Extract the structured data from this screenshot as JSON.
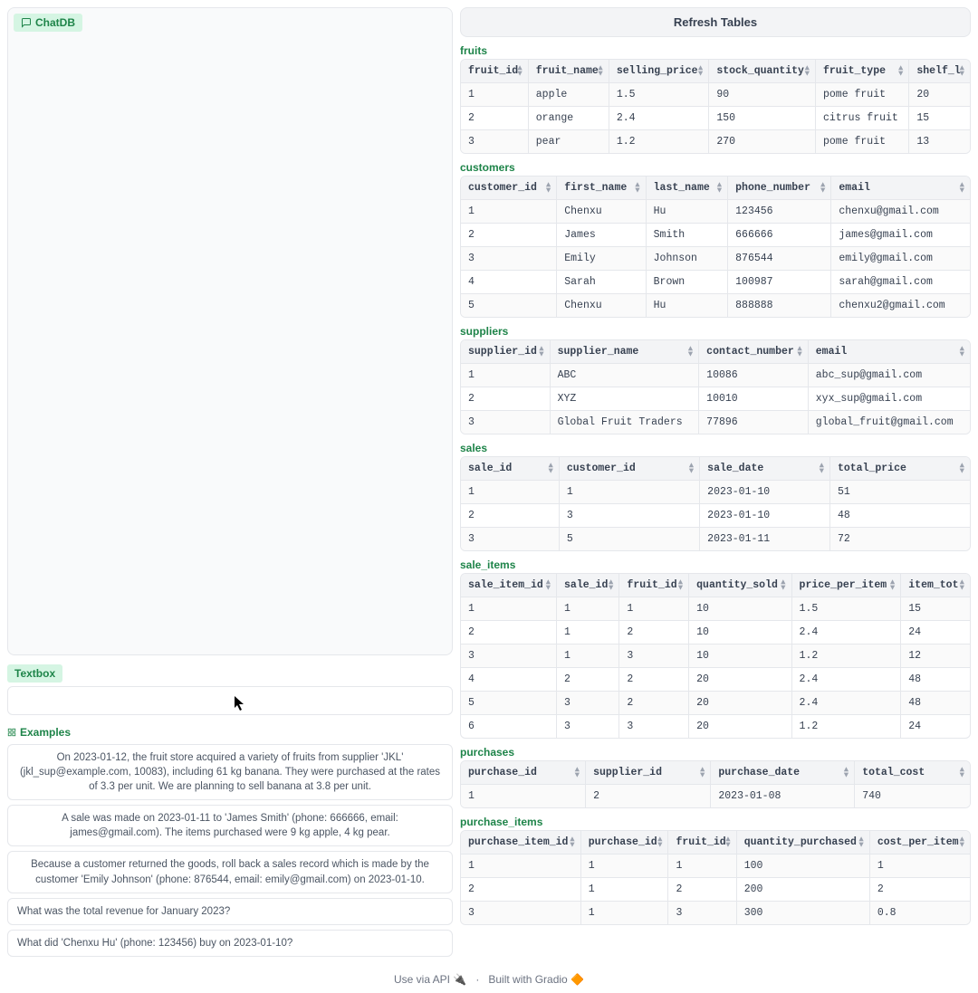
{
  "chat": {
    "label": "ChatDB"
  },
  "textbox": {
    "label": "Textbox",
    "placeholder": ""
  },
  "examples": {
    "label": "Examples",
    "items": [
      "On 2023-01-12, the fruit store acquired a variety of fruits from supplier 'JKL' (jkl_sup@example.com, 10083), including 61 kg banana. They were purchased at the rates of 3.3 per unit. We are planning to sell banana at 3.8 per unit.",
      "A sale was made on 2023-01-11 to 'James Smith' (phone: 666666, email: james@gmail.com). The items purchased were 9 kg apple, 4 kg pear.",
      "Because a customer returned the goods, roll back a sales record which is made by the customer 'Emily Johnson' (phone: 876544, email: emily@gmail.com) on 2023-01-10.",
      "What was the total revenue for January 2023?",
      "What did 'Chenxu Hu' (phone: 123456) buy on 2023-01-10?"
    ]
  },
  "refresh_label": "Refresh Tables",
  "tables": [
    {
      "name": "fruits",
      "columns": [
        "fruit_id",
        "fruit_name",
        "selling_price",
        "stock_quantity",
        "fruit_type",
        "shelf_l"
      ],
      "rows": [
        [
          "1",
          "apple",
          "1.5",
          "90",
          "pome fruit",
          "20"
        ],
        [
          "2",
          "orange",
          "2.4",
          "150",
          "citrus fruit",
          "15"
        ],
        [
          "3",
          "pear",
          "1.2",
          "270",
          "pome fruit",
          "13"
        ]
      ]
    },
    {
      "name": "customers",
      "columns": [
        "customer_id",
        "first_name",
        "last_name",
        "phone_number",
        "email"
      ],
      "rows": [
        [
          "1",
          "Chenxu",
          "Hu",
          "123456",
          "chenxu@gmail.com"
        ],
        [
          "2",
          "James",
          "Smith",
          "666666",
          "james@gmail.com"
        ],
        [
          "3",
          "Emily",
          "Johnson",
          "876544",
          "emily@gmail.com"
        ],
        [
          "4",
          "Sarah",
          "Brown",
          "100987",
          "sarah@gmail.com"
        ],
        [
          "5",
          "Chenxu",
          "Hu",
          "888888",
          "chenxu2@gmail.com"
        ]
      ]
    },
    {
      "name": "suppliers",
      "columns": [
        "supplier_id",
        "supplier_name",
        "contact_number",
        "email"
      ],
      "rows": [
        [
          "1",
          "ABC",
          "10086",
          "abc_sup@gmail.com"
        ],
        [
          "2",
          "XYZ",
          "10010",
          "xyx_sup@gmail.com"
        ],
        [
          "3",
          "Global Fruit Traders",
          "77896",
          "global_fruit@gmail.com"
        ]
      ]
    },
    {
      "name": "sales",
      "columns": [
        "sale_id",
        "customer_id",
        "sale_date",
        "total_price"
      ],
      "rows": [
        [
          "1",
          "1",
          "2023-01-10",
          "51"
        ],
        [
          "2",
          "3",
          "2023-01-10",
          "48"
        ],
        [
          "3",
          "5",
          "2023-01-11",
          "72"
        ]
      ]
    },
    {
      "name": "sale_items",
      "columns": [
        "sale_item_id",
        "sale_id",
        "fruit_id",
        "quantity_sold",
        "price_per_item",
        "item_tot"
      ],
      "rows": [
        [
          "1",
          "1",
          "1",
          "10",
          "1.5",
          "15"
        ],
        [
          "2",
          "1",
          "2",
          "10",
          "2.4",
          "24"
        ],
        [
          "3",
          "1",
          "3",
          "10",
          "1.2",
          "12"
        ],
        [
          "4",
          "2",
          "2",
          "20",
          "2.4",
          "48"
        ],
        [
          "5",
          "3",
          "2",
          "20",
          "2.4",
          "48"
        ],
        [
          "6",
          "3",
          "3",
          "20",
          "1.2",
          "24"
        ]
      ]
    },
    {
      "name": "purchases",
      "columns": [
        "purchase_id",
        "supplier_id",
        "purchase_date",
        "total_cost"
      ],
      "rows": [
        [
          "1",
          "2",
          "2023-01-08",
          "740"
        ]
      ]
    },
    {
      "name": "purchase_items",
      "columns": [
        "purchase_item_id",
        "purchase_id",
        "fruit_id",
        "quantity_purchased",
        "cost_per_item"
      ],
      "rows": [
        [
          "1",
          "1",
          "1",
          "100",
          "1"
        ],
        [
          "2",
          "1",
          "2",
          "200",
          "2"
        ],
        [
          "3",
          "1",
          "3",
          "300",
          "0.8"
        ]
      ]
    }
  ],
  "footer": {
    "api": "Use via API",
    "api_icon": "🔌",
    "sep": "·",
    "built": "Built with Gradio",
    "gradio_icon": "🔶"
  }
}
